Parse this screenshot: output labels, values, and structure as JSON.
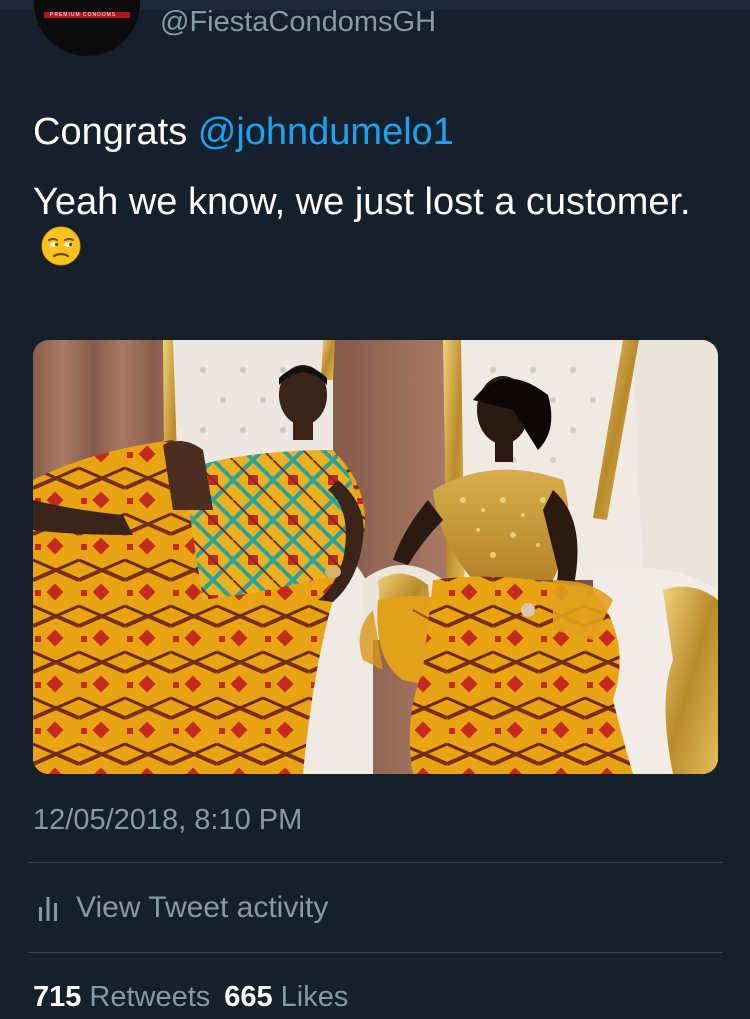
{
  "tweet": {
    "handle": "@FiestaCondomsGH",
    "avatar_text": "PREMIUM CONDOMS",
    "text_line1_prefix": "Congrats ",
    "mention": "@johndumelo1",
    "text_line2": "Yeah we know, we just lost a customer.",
    "emoji": "unamused-face-emoji",
    "image": "wedding-photo",
    "timestamp": "12/05/2018, 8:10 PM"
  },
  "activity": {
    "label": "View Tweet activity",
    "icon": "bar-chart-icon"
  },
  "stats": {
    "retweets_count": "715",
    "retweets_label": "Retweets",
    "likes_count": "665",
    "likes_label": "Likes"
  },
  "colors": {
    "background": "#15202b",
    "mention": "#1da1f2",
    "secondary_text": "#8899a6",
    "divider": "#38444d"
  }
}
